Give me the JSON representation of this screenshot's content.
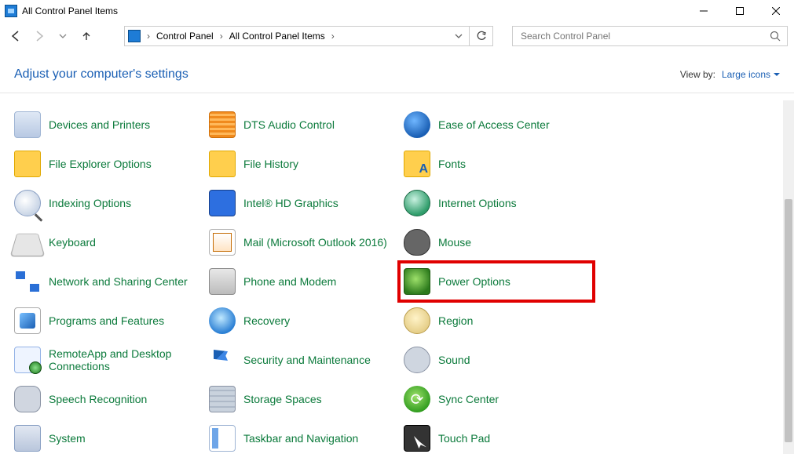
{
  "window": {
    "title": "All Control Panel Items"
  },
  "breadcrumb": {
    "items": [
      "Control Panel",
      "All Control Panel Items"
    ]
  },
  "search": {
    "placeholder": "Search Control Panel"
  },
  "header": {
    "title": "Adjust your computer's settings",
    "viewby_label": "View by:",
    "viewby_value": "Large icons"
  },
  "items": [
    {
      "label": "Devices and Printers",
      "icon": "i-gen"
    },
    {
      "label": "DTS Audio Control",
      "icon": "i-orange"
    },
    {
      "label": "Ease of Access Center",
      "icon": "i-blue"
    },
    {
      "label": "File Explorer Options",
      "icon": "i-folder"
    },
    {
      "label": "File History",
      "icon": "i-folder"
    },
    {
      "label": "Fonts",
      "icon": "i-folderA"
    },
    {
      "label": "Indexing Options",
      "icon": "i-mag"
    },
    {
      "label": "Intel® HD Graphics",
      "icon": "i-intel"
    },
    {
      "label": "Internet Options",
      "icon": "i-globe"
    },
    {
      "label": "Keyboard",
      "icon": "i-kb"
    },
    {
      "label": "Mail (Microsoft Outlook 2016)",
      "icon": "i-mail"
    },
    {
      "label": "Mouse",
      "icon": "i-mouse"
    },
    {
      "label": "Network and Sharing Center",
      "icon": "i-net"
    },
    {
      "label": "Phone and Modem",
      "icon": "i-phone"
    },
    {
      "label": "Power Options",
      "icon": "i-power",
      "highlight": true
    },
    {
      "label": "Programs and Features",
      "icon": "i-prog"
    },
    {
      "label": "Recovery",
      "icon": "i-recov"
    },
    {
      "label": "Region",
      "icon": "i-region"
    },
    {
      "label": "RemoteApp and Desktop Connections",
      "icon": "i-remote"
    },
    {
      "label": "Security and Maintenance",
      "icon": "i-flag"
    },
    {
      "label": "Sound",
      "icon": "i-sound"
    },
    {
      "label": "Speech Recognition",
      "icon": "i-mic"
    },
    {
      "label": "Storage Spaces",
      "icon": "i-disks"
    },
    {
      "label": "Sync Center",
      "icon": "i-sync"
    },
    {
      "label": "System",
      "icon": "i-sys"
    },
    {
      "label": "Taskbar and Navigation",
      "icon": "i-task"
    },
    {
      "label": "Touch Pad",
      "icon": "i-touch"
    }
  ]
}
